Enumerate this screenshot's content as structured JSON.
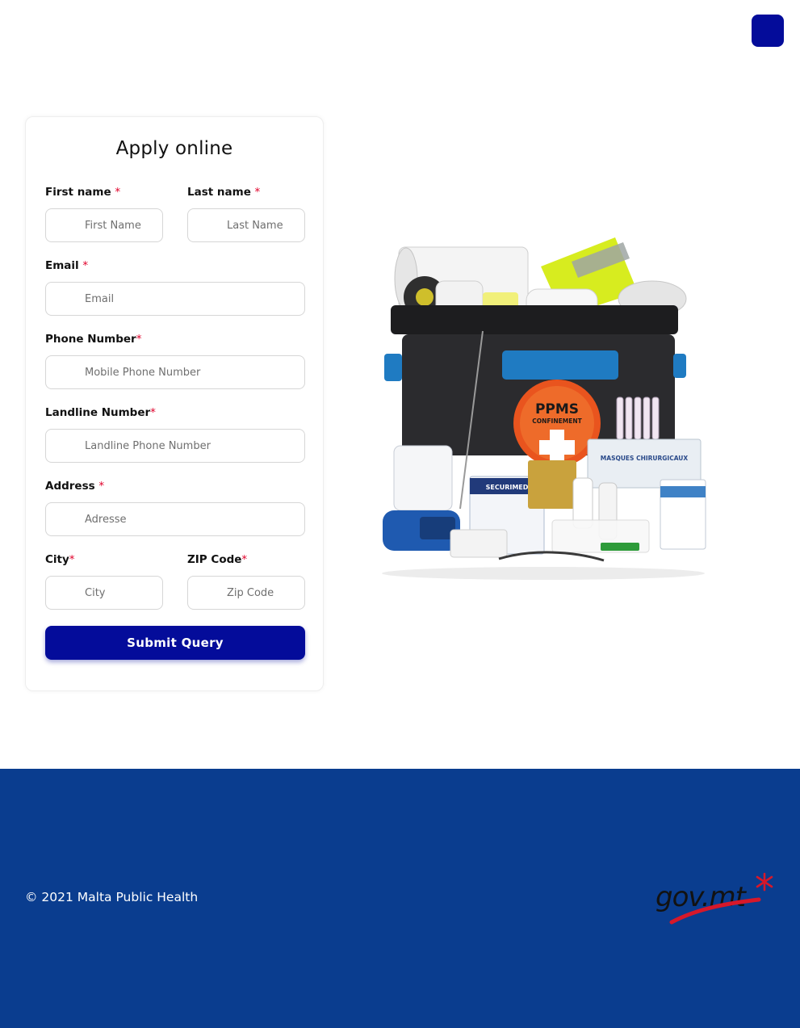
{
  "header": {
    "menu_icon": "hamburger-menu-icon",
    "accent_color": "#040c9a"
  },
  "form": {
    "title": "Apply online",
    "required_marker": "*",
    "fields": {
      "first_name": {
        "label": "First name ",
        "placeholder": "First Name",
        "value": ""
      },
      "last_name": {
        "label": "Last name ",
        "placeholder": "Last Name",
        "value": ""
      },
      "email": {
        "label": "Email ",
        "placeholder": "Email",
        "value": ""
      },
      "phone": {
        "label": "Phone Number",
        "placeholder": "Mobile Phone Number",
        "value": ""
      },
      "landline": {
        "label": "Landline Number",
        "placeholder": "Landline Phone Number",
        "value": ""
      },
      "address": {
        "label": "Address ",
        "placeholder": "Adresse",
        "value": ""
      },
      "city": {
        "label": "City",
        "placeholder": "City",
        "value": ""
      },
      "zip": {
        "label": "ZIP Code",
        "placeholder": "Zip Code",
        "value": ""
      }
    },
    "submit_label": "Submit Query"
  },
  "illustration": {
    "badge_title": "PPMS",
    "badge_subtitle": "CONFINEMENT",
    "box_label": "MASQUES CHIRURGICAUX",
    "pack_label": "SECURIMED"
  },
  "footer": {
    "copyright": "© 2021 Malta Public Health",
    "logo_text": "gov.mt",
    "background_color": "#0a3d8f"
  }
}
